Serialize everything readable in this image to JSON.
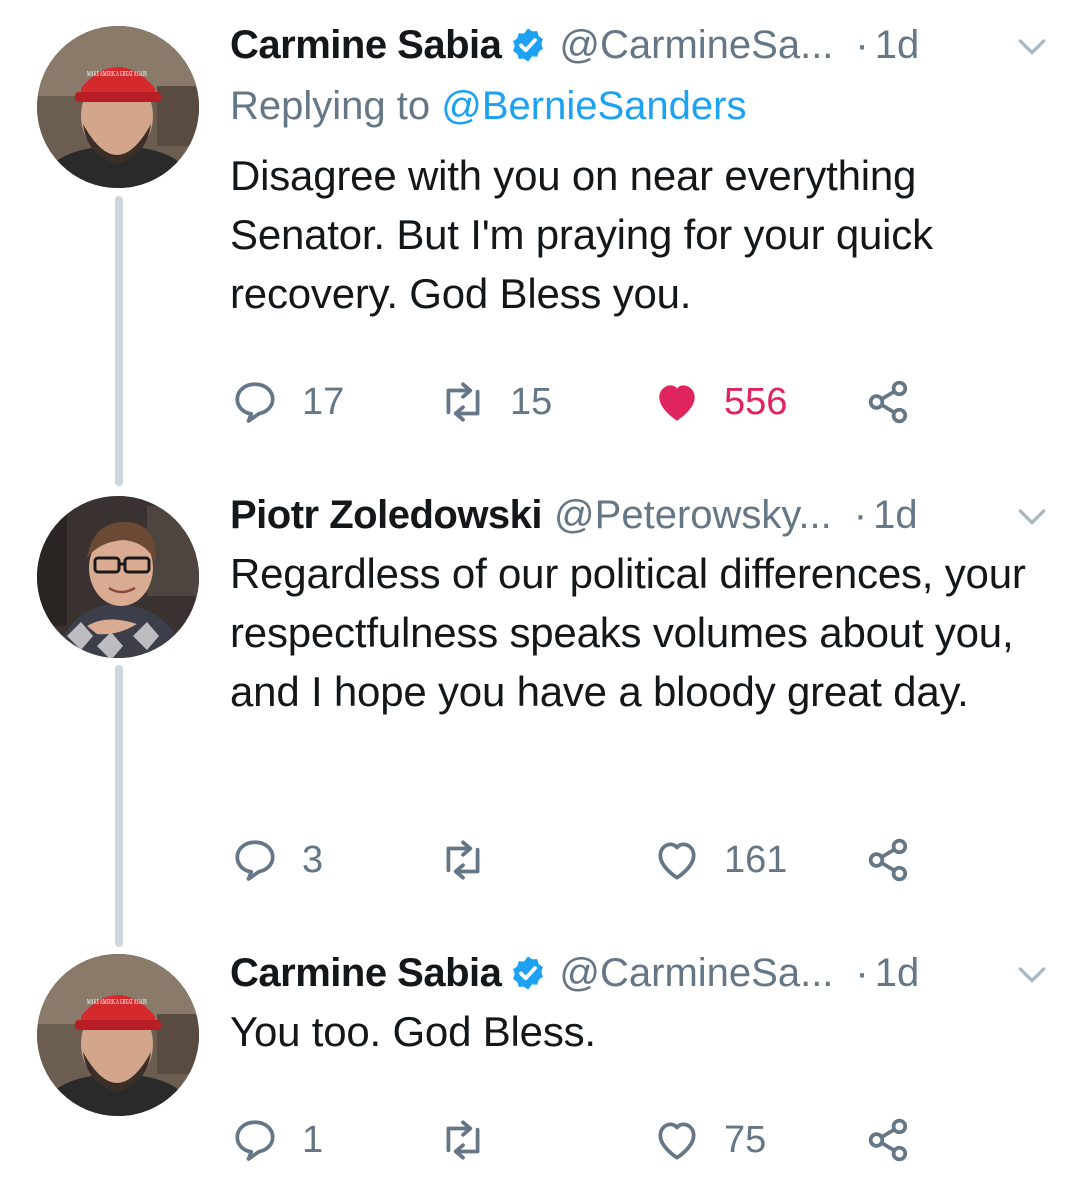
{
  "tweets": [
    {
      "name": "Carmine Sabia",
      "verified": true,
      "handle": "@CarmineSa...",
      "dot": "·",
      "time": "1d",
      "reply_prefix": "Replying to",
      "reply_to": "@BernieSanders",
      "text": "Disagree with you on near everything Senator. But I'm praying for your quick recovery. God Bless you.",
      "replies": "17",
      "retweets": "15",
      "likes": "556",
      "liked": true,
      "hat_text": "MAKE AMERICA GREAT AGAIN"
    },
    {
      "name": "Piotr Zoledowski",
      "verified": false,
      "handle": "@Peterowsky...",
      "dot": "·",
      "time": "1d",
      "text": "Regardless of our political differences, your respectfulness speaks volumes about you, and I hope you have a bloody great day.",
      "replies": "3",
      "retweets": "",
      "likes": "161",
      "liked": false
    },
    {
      "name": "Carmine Sabia",
      "verified": true,
      "handle": "@CarmineSa...",
      "dot": "·",
      "time": "1d",
      "text": "You too. God Bless.",
      "replies": "1",
      "retweets": "",
      "likes": "75",
      "liked": false,
      "hat_text": "MAKE AMERICA GREAT AGAIN"
    }
  ],
  "icons": {
    "reply": "reply-icon",
    "retweet": "retweet-icon",
    "like": "heart-icon",
    "share": "share-icon",
    "verified": "verified-badge-icon",
    "menu": "chevron-down-icon"
  },
  "colors": {
    "link": "#1da1f2",
    "muted": "#657786",
    "like": "#e0245e",
    "thread_line": "#ccd6dd"
  }
}
